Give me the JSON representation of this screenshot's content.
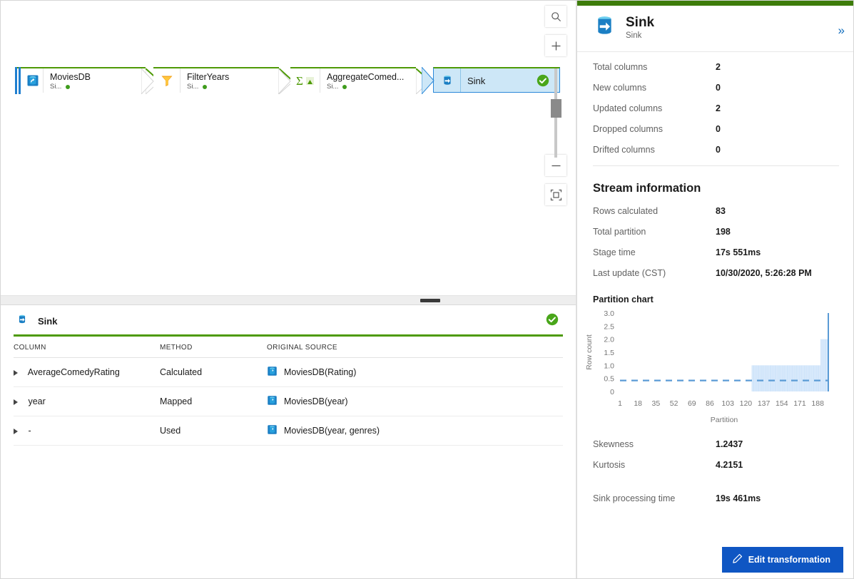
{
  "canvas": {
    "nodes": [
      {
        "name": "MoviesDB",
        "sub": "Si...",
        "icon": "database-source-icon",
        "status": "ok",
        "selected": false,
        "source_accent": true
      },
      {
        "name": "FilterYears",
        "sub": "Si...",
        "icon": "filter-funnel-icon",
        "status": "ok",
        "selected": false,
        "source_accent": false
      },
      {
        "name": "AggregateComed...",
        "sub": "Si...",
        "icon": "aggregate-sigma-icon",
        "status": "ok",
        "selected": false,
        "source_accent": false
      },
      {
        "name": "Sink",
        "sub": "",
        "icon": "database-sink-icon",
        "status": "check",
        "selected": true,
        "source_accent": false
      }
    ],
    "zoom_tools": [
      {
        "name": "search-icon",
        "glyph": "search"
      },
      {
        "name": "zoom-in-icon",
        "glyph": "plus"
      },
      {
        "name": "zoom-out-icon",
        "glyph": "minus"
      },
      {
        "name": "fit-to-screen-icon",
        "glyph": "fit"
      }
    ]
  },
  "table": {
    "title": "Sink",
    "status": "check",
    "headers": [
      "COLUMN",
      "METHOD",
      "ORIGINAL SOURCE"
    ],
    "rows": [
      {
        "column": "AverageComedyRating",
        "method": "Calculated",
        "source": "MoviesDB(Rating)"
      },
      {
        "column": "year",
        "method": "Mapped",
        "source": "MoviesDB(year)"
      },
      {
        "column": "-",
        "method": "Used",
        "source": "MoviesDB(year, genres)"
      }
    ]
  },
  "panel": {
    "title": "Sink",
    "subtitle": "Sink",
    "collapse_glyph": "»",
    "column_stats": [
      {
        "label": "Total columns",
        "value": "2"
      },
      {
        "label": "New columns",
        "value": "0"
      },
      {
        "label": "Updated columns",
        "value": "2"
      },
      {
        "label": "Dropped columns",
        "value": "0"
      },
      {
        "label": "Drifted columns",
        "value": "0"
      }
    ],
    "stream_section_title": "Stream information",
    "stream_stats": [
      {
        "label": "Rows calculated",
        "value": "83"
      },
      {
        "label": "Total partition",
        "value": "198"
      },
      {
        "label": "Stage time",
        "value": "17s 551ms"
      },
      {
        "label": "Last update (CST)",
        "value": "10/30/2020, 5:26:28 PM"
      }
    ],
    "chart_title": "Partition chart",
    "shape_stats": [
      {
        "label": "Skewness",
        "value": "1.2437"
      },
      {
        "label": "Kurtosis",
        "value": "4.2151"
      }
    ],
    "processing": [
      {
        "label": "Sink processing time",
        "value": "19s 461ms"
      }
    ],
    "edit_button": "Edit transformation",
    "edit_icon": "pencil-icon",
    "accent_color": "#0f56c3",
    "header_bar_color": "#3d7c0a"
  },
  "chart_data": {
    "type": "bar",
    "title": "Partition chart",
    "xlabel": "Partition",
    "ylabel": "Row count",
    "xlim": [
      1,
      198
    ],
    "ylim": [
      0,
      3.0
    ],
    "xticks": [
      1,
      18,
      35,
      52,
      69,
      86,
      103,
      120,
      137,
      154,
      171,
      188
    ],
    "yticks": [
      "0",
      "0.5",
      "1.0",
      "1.5",
      "2.0",
      "2.5",
      "3.0"
    ],
    "grid": false,
    "legend": null,
    "bar_color": "#cfe4fa",
    "line_color": "#5b9bd5",
    "mean_line": {
      "value": 0.42,
      "style": "dashed",
      "color": "#5b9bd5"
    },
    "segments": [
      {
        "x_start": 1,
        "x_end": 125,
        "value": 0
      },
      {
        "x_start": 126,
        "x_end": 190,
        "value": 1.0
      },
      {
        "x_start": 191,
        "x_end": 197,
        "value": 2.0
      },
      {
        "x_start": 198,
        "x_end": 198,
        "value": 3.0
      }
    ]
  }
}
